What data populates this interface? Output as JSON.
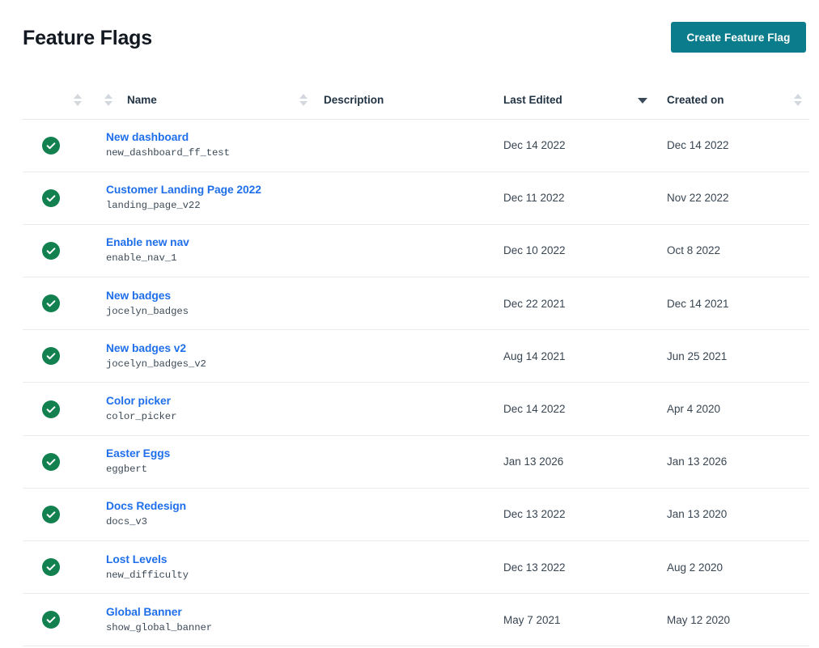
{
  "header": {
    "title": "Feature Flags",
    "create_button_label": "Create Feature Flag",
    "accent_color": "#0b7c8c"
  },
  "table": {
    "columns": [
      {
        "key": "status",
        "label": "",
        "sortable": true,
        "sort_state": "none"
      },
      {
        "key": "name",
        "label": "Name",
        "sortable": true,
        "sort_state": "none"
      },
      {
        "key": "desc",
        "label": "Description",
        "sortable": true,
        "sort_state": "none"
      },
      {
        "key": "edited",
        "label": "Last Edited",
        "sortable": true,
        "sort_state": "desc"
      },
      {
        "key": "created",
        "label": "Created on",
        "sortable": true,
        "sort_state": "none"
      }
    ],
    "status_icon": "check-circle-icon",
    "status_color": "#12804f",
    "link_color": "#1f6feb",
    "rows": [
      {
        "status": "enabled",
        "name": "New dashboard",
        "key": "new_dashboard_ff_test",
        "description": "",
        "last_edited": "Dec 14 2022",
        "created_on": "Dec 14 2022"
      },
      {
        "status": "enabled",
        "name": "Customer Landing Page 2022",
        "key": "landing_page_v22",
        "description": "",
        "last_edited": "Dec 11 2022",
        "created_on": "Nov 22 2022"
      },
      {
        "status": "enabled",
        "name": "Enable new nav",
        "key": "enable_nav_1",
        "description": "",
        "last_edited": "Dec 10 2022",
        "created_on": "Oct 8 2022"
      },
      {
        "status": "enabled",
        "name": "New badges",
        "key": "jocelyn_badges",
        "description": "",
        "last_edited": "Dec 22 2021",
        "created_on": "Dec 14 2021"
      },
      {
        "status": "enabled",
        "name": "New badges v2",
        "key": "jocelyn_badges_v2",
        "description": "",
        "last_edited": "Aug 14 2021",
        "created_on": "Jun 25 2021"
      },
      {
        "status": "enabled",
        "name": "Color picker",
        "key": "color_picker",
        "description": "",
        "last_edited": "Dec 14 2022",
        "created_on": "Apr 4 2020"
      },
      {
        "status": "enabled",
        "name": "Easter Eggs",
        "key": "eggbert",
        "description": "",
        "last_edited": "Jan 13 2026",
        "created_on": "Jan 13 2026"
      },
      {
        "status": "enabled",
        "name": "Docs Redesign",
        "key": "docs_v3",
        "description": "",
        "last_edited": "Dec 13 2022",
        "created_on": "Jan 13 2020"
      },
      {
        "status": "enabled",
        "name": "Lost Levels",
        "key": "new_difficulty",
        "description": "",
        "last_edited": "Dec 13 2022",
        "created_on": "Aug 2 2020"
      },
      {
        "status": "enabled",
        "name": "Global Banner",
        "key": "show_global_banner",
        "description": "",
        "last_edited": "May 7 2021",
        "created_on": "May 12 2020"
      }
    ]
  }
}
